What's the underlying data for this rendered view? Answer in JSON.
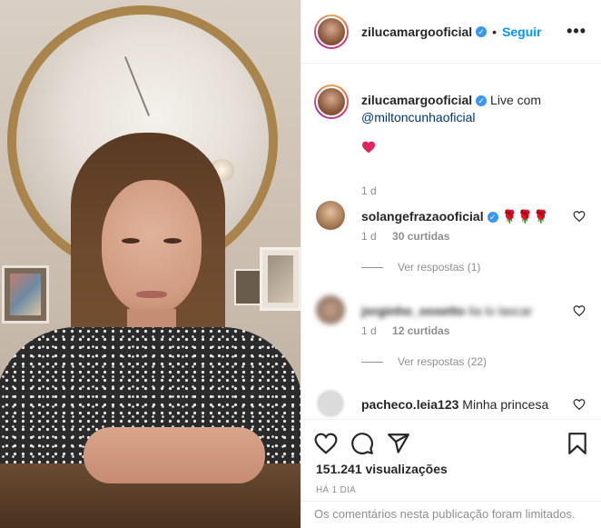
{
  "post": {
    "author": "zilucamargooficial",
    "follow_label": "Seguir",
    "more_label": "•••",
    "dot": "•"
  },
  "caption": {
    "author": "zilucamargooficial",
    "text": " Live com ",
    "mention": "@miltoncunhaoficial",
    "emoji": "❤️",
    "time": "1 d"
  },
  "comments": [
    {
      "user": "solangefrazaooficial",
      "text": "🌹🌹🌹",
      "time": "1 d",
      "likes": "30 curtidas",
      "replies": "Ver respostas (1)"
    },
    {
      "user": "jorginho_oosetto",
      "text": "lia lo lascar",
      "time": "1 d",
      "likes": "12 curtidas",
      "replies": "Ver respostas (22)"
    },
    {
      "user": "pacheco.leia123",
      "text": "Minha princesa"
    }
  ],
  "actions": {
    "views": "151.241 visualizações",
    "time": "HÁ 1 DIA"
  },
  "footer": {
    "limited_text": "Os comentários nesta publicação foram limitados."
  },
  "colors": {
    "accent": "#0095f6",
    "verified": "#3897f0",
    "muted": "#8e8e8e",
    "heart_red": "#ed4956"
  }
}
